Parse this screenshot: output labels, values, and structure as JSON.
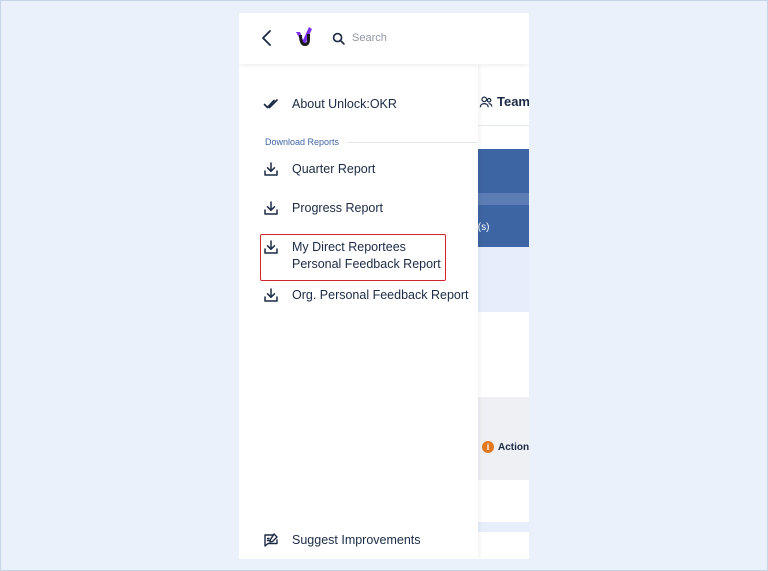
{
  "header": {
    "search_placeholder": "Search"
  },
  "background": {
    "team_label": "Team",
    "blue_text": "t(s)",
    "action_label": "Action",
    "alert_glyph": "i"
  },
  "drawer": {
    "about_label": "About Unlock:OKR",
    "section_title": "Download Reports",
    "reports": [
      {
        "label": "Quarter Report"
      },
      {
        "label": "Progress Report"
      },
      {
        "label_line1": "My Direct Reportees",
        "label_line2": "Personal Feedback Report"
      },
      {
        "label": "Org. Personal Feedback Report"
      }
    ],
    "suggest_label": "Suggest Improvements"
  },
  "colors": {
    "accent": "#3e65a3",
    "highlight": "#d2242c",
    "text": "#1b2a44",
    "logo_purple": "#7b2ff7"
  }
}
